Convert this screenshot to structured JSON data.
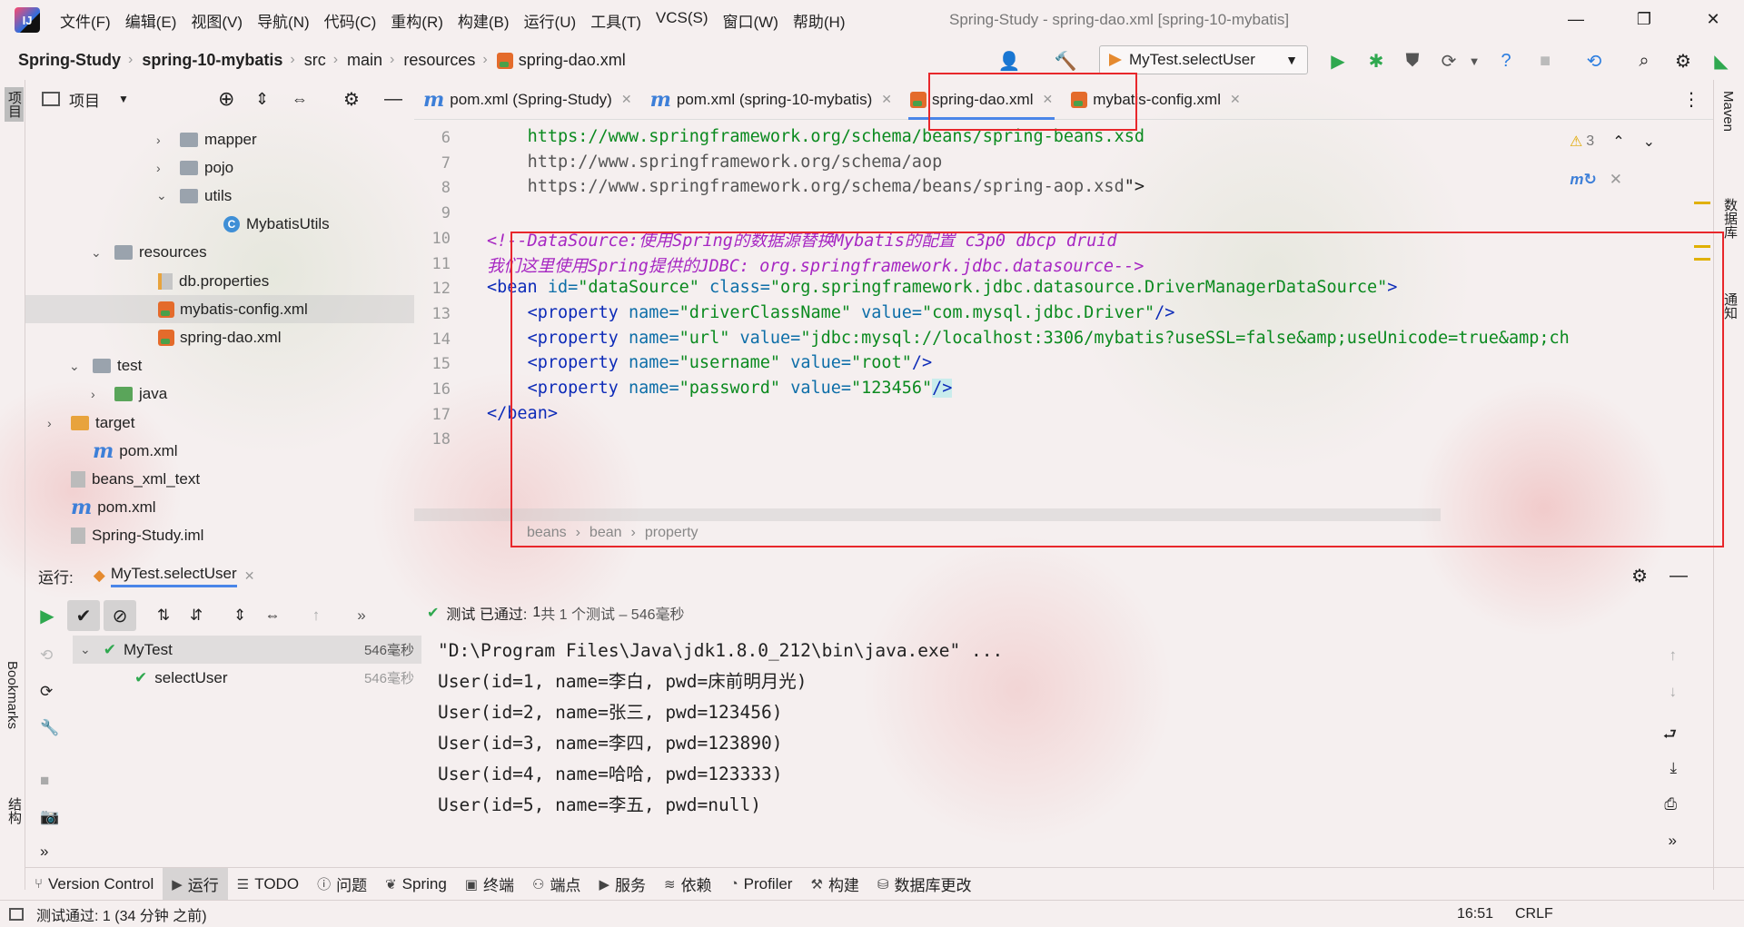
{
  "menu": {
    "items": [
      "文件(F)",
      "编辑(E)",
      "视图(V)",
      "导航(N)",
      "代码(C)",
      "重构(R)",
      "构建(B)",
      "运行(U)",
      "工具(T)",
      "VCS(S)",
      "窗口(W)",
      "帮助(H)"
    ],
    "window_title": "Spring-Study - spring-dao.xml [spring-10-mybatis]"
  },
  "navbar": {
    "crumbs": [
      "Spring-Study",
      "spring-10-mybatis",
      "src",
      "main",
      "resources",
      "spring-dao.xml"
    ],
    "run_config": "MyTest.selectUser"
  },
  "left_strip": {
    "project": "项目",
    "bookmarks": "Bookmarks",
    "structure": "结构"
  },
  "right_strip": {
    "maven": "Maven",
    "database": "数据库",
    "notifications": "通知"
  },
  "project_panel": {
    "title": "项目",
    "tree": [
      {
        "label": "mapper",
        "kind": "folder",
        "arrow": "›"
      },
      {
        "label": "pojo",
        "kind": "folder",
        "arrow": "›"
      },
      {
        "label": "utils",
        "kind": "folder",
        "arrow": "⌄"
      },
      {
        "label": "MybatisUtils",
        "kind": "class"
      },
      {
        "label": "resources",
        "kind": "folder-res",
        "arrow": "⌄"
      },
      {
        "label": "db.properties",
        "kind": "props"
      },
      {
        "label": "mybatis-config.xml",
        "kind": "xml",
        "selected": true
      },
      {
        "label": "spring-dao.xml",
        "kind": "xml"
      },
      {
        "label": "test",
        "kind": "folder",
        "arrow": "⌄"
      },
      {
        "label": "java",
        "kind": "folder-green",
        "arrow": "›"
      },
      {
        "label": "target",
        "kind": "folder-orange",
        "arrow": "›"
      },
      {
        "label": "pom.xml",
        "kind": "maven"
      },
      {
        "label": "beans_xml_text",
        "kind": "plain"
      },
      {
        "label": "pom.xml",
        "kind": "maven"
      },
      {
        "label": "Spring-Study.iml",
        "kind": "plain"
      }
    ]
  },
  "editor_tabs": [
    {
      "label": "pom.xml (Spring-Study)",
      "kind": "maven"
    },
    {
      "label": "pom.xml (spring-10-mybatis)",
      "kind": "maven"
    },
    {
      "label": "spring-dao.xml",
      "kind": "xml",
      "active": true
    },
    {
      "label": "mybatis-config.xml",
      "kind": "xml"
    }
  ],
  "editor": {
    "warnings": "3",
    "line_numbers": [
      "6",
      "7",
      "8",
      "9",
      "10",
      "11",
      "12",
      "13",
      "14",
      "15",
      "16",
      "17",
      "18"
    ],
    "lines": [
      {
        "indent": "    ",
        "parts": [
          {
            "t": "https://www.springframework.org/schema/beans/spring-beans.xsd",
            "c": "url"
          }
        ]
      },
      {
        "indent": "    ",
        "parts": [
          {
            "t": "http://www.springframework.org/schema/aop",
            "c": "gray"
          }
        ]
      },
      {
        "indent": "    ",
        "parts": [
          {
            "t": "https://www.springframework.org/schema/beans/spring-aop.xsd",
            "c": "gray"
          },
          {
            "t": "\">",
            "c": "plain"
          }
        ]
      },
      {
        "indent": "",
        "parts": []
      },
      {
        "indent": "",
        "parts": [
          {
            "t": "<!--DataSource:使用Spring的数据源替换Mybatis的配置 c3p0 dbcp druid",
            "c": "comment"
          }
        ]
      },
      {
        "indent": "",
        "parts": [
          {
            "t": "我们这里使用Spring提供的JDBC: org.springframework.jdbc.datasource-->",
            "c": "comment"
          }
        ]
      },
      {
        "indent": "",
        "parts": [
          {
            "t": "<bean ",
            "c": "tag"
          },
          {
            "t": "id=",
            "c": "attr"
          },
          {
            "t": "\"dataSource\" ",
            "c": "val"
          },
          {
            "t": "class=",
            "c": "attr"
          },
          {
            "t": "\"org.springframework.jdbc.datasource.DriverManagerDataSource\"",
            "c": "val"
          },
          {
            "t": ">",
            "c": "tag"
          }
        ]
      },
      {
        "indent": "    ",
        "parts": [
          {
            "t": "<property ",
            "c": "tag"
          },
          {
            "t": "name=",
            "c": "attr"
          },
          {
            "t": "\"driverClassName\" ",
            "c": "val"
          },
          {
            "t": "value=",
            "c": "attr"
          },
          {
            "t": "\"com.mysql.jdbc.Driver\"",
            "c": "val"
          },
          {
            "t": "/>",
            "c": "tag"
          }
        ]
      },
      {
        "indent": "    ",
        "parts": [
          {
            "t": "<property ",
            "c": "tag"
          },
          {
            "t": "name=",
            "c": "attr"
          },
          {
            "t": "\"url\" ",
            "c": "val"
          },
          {
            "t": "value=",
            "c": "attr"
          },
          {
            "t": "\"jdbc:mysql://localhost:3306/mybatis?useSSL=false&amp;useUnicode=true&amp;ch",
            "c": "val"
          }
        ]
      },
      {
        "indent": "    ",
        "parts": [
          {
            "t": "<property ",
            "c": "tag"
          },
          {
            "t": "name=",
            "c": "attr"
          },
          {
            "t": "\"username\" ",
            "c": "val"
          },
          {
            "t": "value=",
            "c": "attr"
          },
          {
            "t": "\"root\"",
            "c": "val"
          },
          {
            "t": "/>",
            "c": "tag"
          }
        ]
      },
      {
        "indent": "    ",
        "parts": [
          {
            "t": "<property ",
            "c": "tag"
          },
          {
            "t": "name=",
            "c": "attr"
          },
          {
            "t": "\"password\" ",
            "c": "val"
          },
          {
            "t": "value=",
            "c": "attr"
          },
          {
            "t": "\"123456\"",
            "c": "val"
          },
          {
            "t": "/>",
            "c": "tag hl"
          }
        ]
      },
      {
        "indent": "",
        "parts": [
          {
            "t": "</bean>",
            "c": "tag"
          }
        ]
      },
      {
        "indent": "",
        "parts": []
      }
    ],
    "breadcrumb": [
      "beans",
      "bean",
      "property"
    ]
  },
  "run_panel": {
    "label": "运行:",
    "tab": "MyTest.selectUser",
    "status_prefix": "测试 已通过:",
    "status_count": "1",
    "status_detail": "共 1 个测试 – 546毫秒",
    "tests": [
      {
        "name": "MyTest",
        "time": "546毫秒"
      },
      {
        "name": "selectUser",
        "time": "546毫秒"
      }
    ],
    "console": [
      "\"D:\\Program Files\\Java\\jdk1.8.0_212\\bin\\java.exe\" ...",
      "User(id=1, name=李白, pwd=床前明月光)",
      "User(id=2, name=张三, pwd=123456)",
      "User(id=3, name=李四, pwd=123890)",
      "User(id=4, name=哈哈, pwd=123333)",
      "User(id=5, name=李五, pwd=null)"
    ]
  },
  "bottom_tabs": [
    {
      "label": "Version Control",
      "icon": "branch-icon"
    },
    {
      "label": "运行",
      "icon": "play-icon",
      "active": true
    },
    {
      "label": "TODO",
      "icon": "list-icon"
    },
    {
      "label": "问题",
      "icon": "info-icon"
    },
    {
      "label": "Spring",
      "icon": "leaf-icon"
    },
    {
      "label": "终端",
      "icon": "terminal-icon"
    },
    {
      "label": "端点",
      "icon": "endpoints-icon"
    },
    {
      "label": "服务",
      "icon": "services-icon"
    },
    {
      "label": "依赖",
      "icon": "layers-icon"
    },
    {
      "label": "Profiler",
      "icon": "profiler-icon"
    },
    {
      "label": "构建",
      "icon": "hammer-icon"
    },
    {
      "label": "数据库更改",
      "icon": "db-changes-icon"
    }
  ],
  "statusbar": {
    "message": "测试通过: 1 (34 分钟 之前)",
    "time": "16:51",
    "line_sep": "CRLF"
  },
  "colors": {
    "accent": "#4a86e8",
    "highlight_box": "#e8272b",
    "run_green": "#2fa84f"
  }
}
